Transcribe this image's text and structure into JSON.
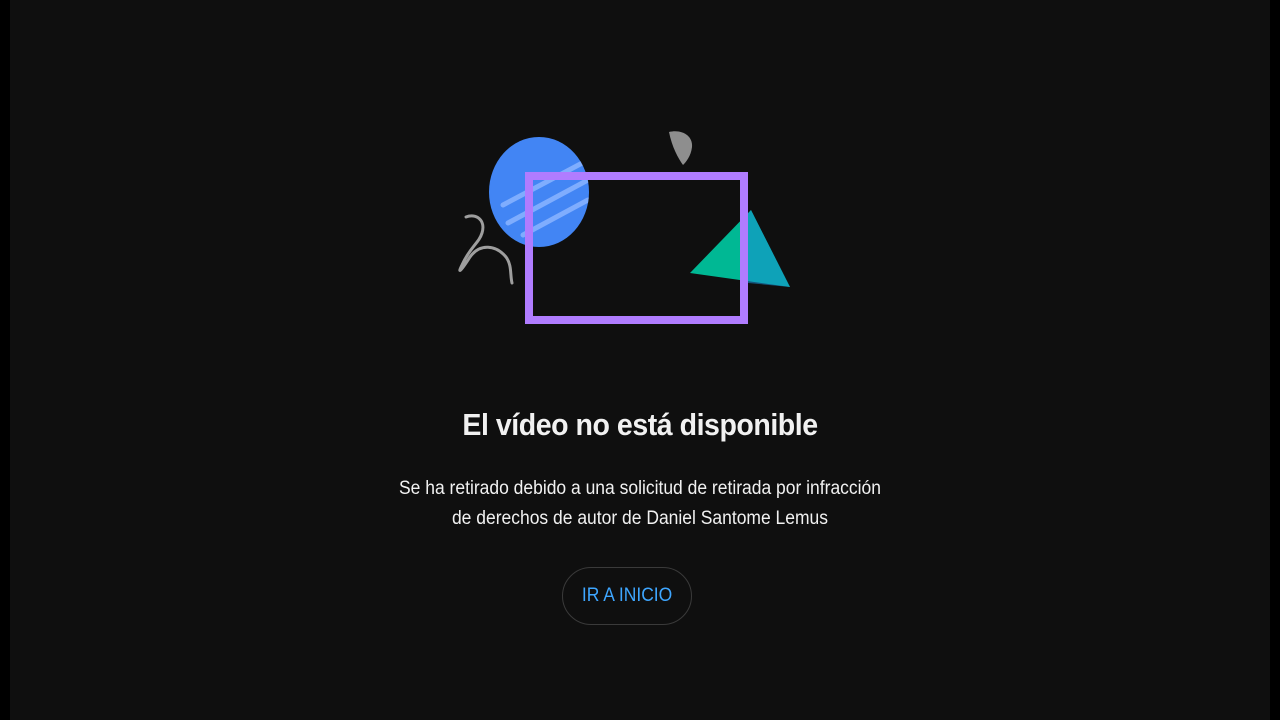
{
  "error": {
    "title": "El vídeo no está disponible",
    "description_lines": [
      "Se ha retirado debido a una solicitud de retirada por infracción",
      "de derechos de autor de Daniel Santome Lemus"
    ],
    "button_label": "IR A INICIO"
  },
  "illustration": {
    "icon": "video-unavailable-illustration",
    "colors": {
      "background": "#0f0f0f",
      "circle": "#4285f4",
      "frame": "#b07cff",
      "triangle": "#00b894",
      "squiggle": "#9e9e9e",
      "button_text": "#3ea6ff"
    }
  }
}
